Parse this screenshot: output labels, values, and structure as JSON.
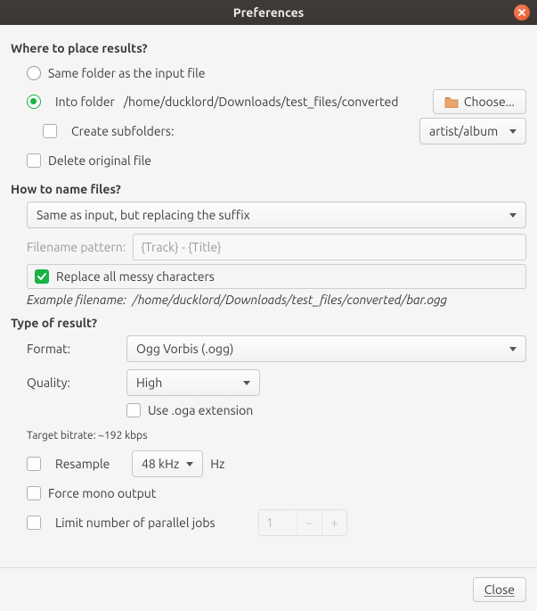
{
  "window": {
    "title": "Preferences",
    "close_button_label": "Close"
  },
  "place": {
    "heading": "Where to place results?",
    "same_label": "Same folder as the input file",
    "into_label": "Into folder",
    "into_path": "/home/ducklord/Downloads/test_files/converted",
    "choose_label": "Choose...",
    "subfolders_label": "Create subfolders:",
    "subfolders_pattern": "artist/album",
    "delete_label": "Delete original file"
  },
  "naming": {
    "heading": "How to name files?",
    "mode": "Same as input, but replacing the suffix",
    "pattern_label": "Filename pattern:",
    "pattern_placeholder": "{Track} - {Title}",
    "replace_messy_label": "Replace all messy characters",
    "example_label": "Example filename:",
    "example_value": "/home/ducklord/Downloads/test_files/converted/bar.ogg"
  },
  "result": {
    "heading": "Type of result?",
    "format_label": "Format:",
    "format_value": "Ogg Vorbis (.ogg)",
    "quality_label": "Quality:",
    "quality_value": "High",
    "oga_label": "Use .oga extension",
    "bitrate_line": "Target bitrate: ~192 kbps",
    "resample_label": "Resample",
    "resample_value": "48 kHz",
    "resample_unit": "Hz",
    "mono_label": "Force mono output",
    "limit_label": "Limit number of parallel jobs",
    "limit_value": "1"
  }
}
